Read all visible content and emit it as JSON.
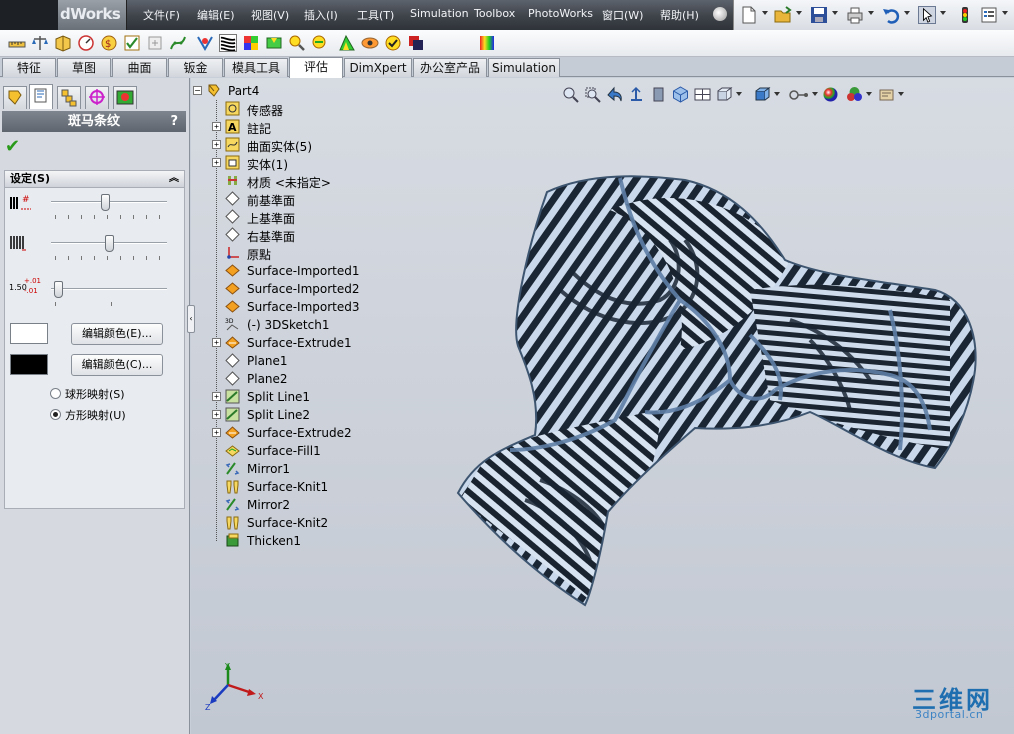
{
  "app": {
    "logo_text": "dWorks"
  },
  "menu": [
    "文件(F)",
    "编辑(E)",
    "视图(V)",
    "插入(I)",
    "工具(T)",
    "Simulation",
    "Toolbox",
    "PhotoWorks",
    "窗口(W)",
    "帮助(H)"
  ],
  "tabs": [
    "特征",
    "草图",
    "曲面",
    "钣金",
    "模具工具",
    "评估",
    "DimXpert",
    "办公室产品",
    "Simulation"
  ],
  "active_tab": "评估",
  "property_manager": {
    "title": "斑马条纹",
    "help": "?",
    "settings": {
      "header": "设定(S)",
      "slider_icons": [
        "stripe-count-icon",
        "stripe-width-icon",
        "precision-icon"
      ],
      "precision_label": "1.50",
      "precision_plus": "+.01",
      "precision_minus": "-.01",
      "slider_levels": [
        0.47,
        0.5,
        0.03
      ],
      "stripe_color": "#ffffff",
      "background_color": "#000000",
      "edit_color_e": "编辑颜色(E)...",
      "edit_color_c": "编辑颜色(C)...",
      "mapping_options": [
        "球形映射(S)",
        "方形映射(U)"
      ],
      "selected_mapping": "方形映射(U)"
    }
  },
  "tree": {
    "root": "Part4",
    "items": [
      {
        "label": "传感器",
        "icon": "sensor-icon",
        "expandable": false
      },
      {
        "label": "註記",
        "icon": "annotations-icon",
        "expandable": true
      },
      {
        "label": "曲面实体(5)",
        "icon": "surface-bodies-icon",
        "expandable": true
      },
      {
        "label": "实体(1)",
        "icon": "solid-bodies-icon",
        "expandable": true
      },
      {
        "label": "材质 <未指定>",
        "icon": "material-icon",
        "expandable": false
      },
      {
        "label": "前基準面",
        "icon": "plane-icon",
        "expandable": false
      },
      {
        "label": "上基準面",
        "icon": "plane-icon",
        "expandable": false
      },
      {
        "label": "右基準面",
        "icon": "plane-icon",
        "expandable": false
      },
      {
        "label": "原點",
        "icon": "origin-icon",
        "expandable": false
      },
      {
        "label": "Surface-Imported1",
        "icon": "surface-imported-icon",
        "expandable": false
      },
      {
        "label": "Surface-Imported2",
        "icon": "surface-imported-icon",
        "expandable": false
      },
      {
        "label": "Surface-Imported3",
        "icon": "surface-imported-icon",
        "expandable": false
      },
      {
        "label": "(-) 3DSketch1",
        "icon": "3dsketch-icon",
        "expandable": false
      },
      {
        "label": "Surface-Extrude1",
        "icon": "surface-extrude-icon",
        "expandable": true
      },
      {
        "label": "Plane1",
        "icon": "plane-icon",
        "expandable": false
      },
      {
        "label": "Plane2",
        "icon": "plane-icon",
        "expandable": false
      },
      {
        "label": "Split Line1",
        "icon": "split-line-icon",
        "expandable": true
      },
      {
        "label": "Split Line2",
        "icon": "split-line-icon",
        "expandable": true
      },
      {
        "label": "Surface-Extrude2",
        "icon": "surface-extrude-icon",
        "expandable": true
      },
      {
        "label": "Surface-Fill1",
        "icon": "surface-fill-icon",
        "expandable": false
      },
      {
        "label": "Mirror1",
        "icon": "mirror-icon",
        "expandable": false
      },
      {
        "label": "Surface-Knit1",
        "icon": "surface-knit-icon",
        "expandable": false
      },
      {
        "label": "Mirror2",
        "icon": "mirror-icon",
        "expandable": false
      },
      {
        "label": "Surface-Knit2",
        "icon": "surface-knit-icon",
        "expandable": false
      },
      {
        "label": "Thicken1",
        "icon": "thicken-icon",
        "expandable": false
      }
    ]
  },
  "triad": {
    "x": "X",
    "y": "Y",
    "z": "Z"
  },
  "watermark": {
    "brand": "三维网",
    "site": "3dportal.cn"
  }
}
